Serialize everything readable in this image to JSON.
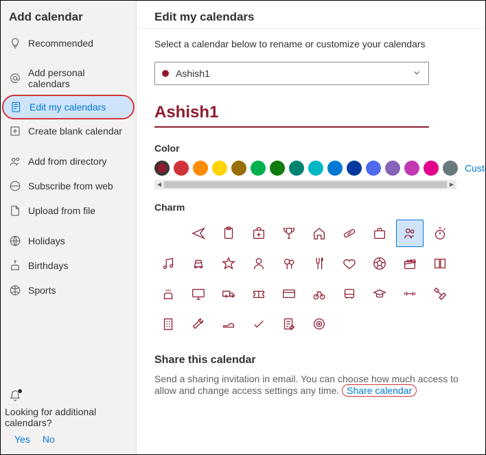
{
  "sidebar": {
    "title": "Add calendar",
    "items": [
      {
        "label": "Recommended",
        "icon": "lightbulb"
      },
      {
        "label": "Add personal calendars",
        "icon": "at"
      },
      {
        "label": "Edit my calendars",
        "icon": "page-edit",
        "selected": true
      },
      {
        "label": "Create blank calendar",
        "icon": "plus-box"
      },
      {
        "label": "Add from directory",
        "icon": "people"
      },
      {
        "label": "Subscribe from web",
        "icon": "globe-sub"
      },
      {
        "label": "Upload from file",
        "icon": "upload"
      },
      {
        "label": "Holidays",
        "icon": "globe"
      },
      {
        "label": "Birthdays",
        "icon": "cake"
      },
      {
        "label": "Sports",
        "icon": "sports"
      }
    ],
    "footer_question_l1": "Looking for additional",
    "footer_question_l2": "calendars?",
    "yes": "Yes",
    "no": "No"
  },
  "main": {
    "heading": "Edit my calendars",
    "subhead": "Select a calendar below to rename or customize your calendars",
    "select_value": "Ashish1",
    "calendar_name": "Ashish1",
    "color_label": "Color",
    "colors": [
      "#8e1b2f",
      "#d13438",
      "#ff8c00",
      "#ffd400",
      "#986f0b",
      "#00b050",
      "#107c10",
      "#008272",
      "#00b7c3",
      "#0078d4",
      "#003a9e",
      "#4f6bed",
      "#8764b8",
      "#c239b3",
      "#e3008c",
      "#69797e"
    ],
    "selected_color_index": 0,
    "custom_label": "Custom",
    "charm_label": "Charm",
    "charms": [
      "blank",
      "plane",
      "clipboard",
      "medkit",
      "trophy",
      "home",
      "pill",
      "briefcase",
      "people",
      "stopwatch",
      "music",
      "car",
      "star",
      "person",
      "balloons",
      "fork",
      "heart",
      "soccer",
      "clapper",
      "book",
      "cake",
      "monitor",
      "truck",
      "ticket",
      "card",
      "bike",
      "bus",
      "gradcap",
      "dumbbell",
      "tools",
      "building",
      "wrench",
      "shoe",
      "check",
      "note-edit",
      "target"
    ],
    "selected_charm_index": 8,
    "share_heading": "Share this calendar",
    "share_text_a": "Send a sharing invitation in email. You can choose how much access to allow and change access settings any time.",
    "share_link": "Share calendar"
  }
}
